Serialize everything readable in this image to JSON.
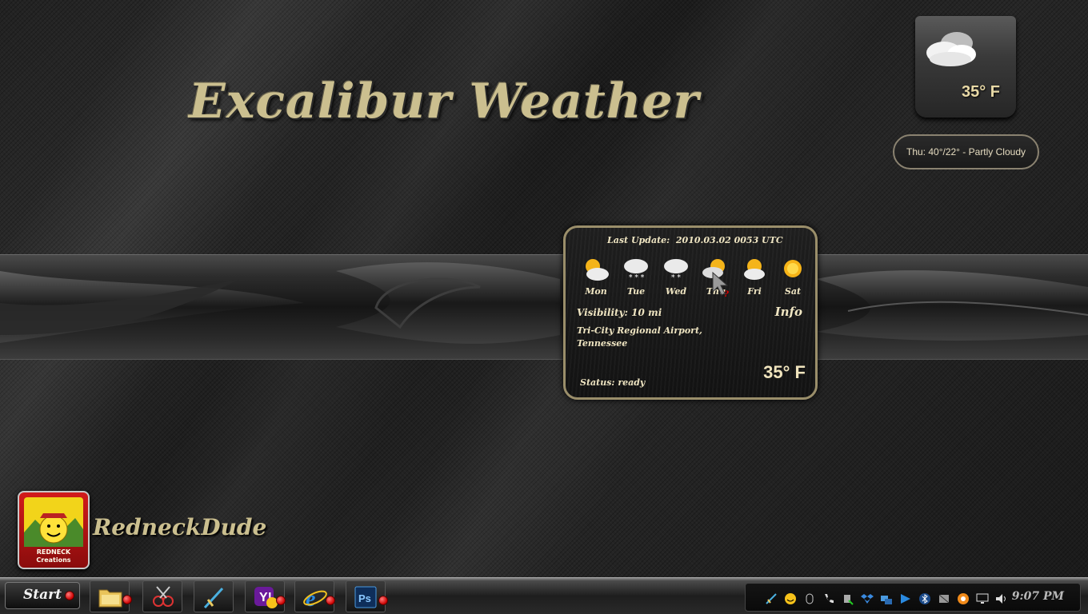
{
  "desktop": {
    "title_logo": "Excalibur Weather",
    "user_name": "RedneckDude",
    "user_badge_text": [
      "REDNECK",
      "Creations"
    ]
  },
  "mini_widget": {
    "temperature": "35° F",
    "icon": "partly-cloudy-icon",
    "forecast": "Thu: 40°/22° - Partly Cloudy"
  },
  "weather_panel": {
    "last_update_label": "Last Update:",
    "last_update_value": "2010.03.02 0053 UTC",
    "days": [
      {
        "label": "Mon",
        "icon": "sun-cloud-icon"
      },
      {
        "label": "Tue",
        "icon": "snow-cloud-icon"
      },
      {
        "label": "Wed",
        "icon": "snow-cloud-icon"
      },
      {
        "label": "Thu",
        "icon": "sun-cloud-icon"
      },
      {
        "label": "Fri",
        "icon": "sun-cloud-icon"
      },
      {
        "label": "Sat",
        "icon": "sun-icon"
      }
    ],
    "visibility": "Visibility: 10 mi",
    "info_link": "Info",
    "location": "Tri-City Regional Airport, Tennessee",
    "status": "Status: ready",
    "temperature": "35° F"
  },
  "taskbar": {
    "start_label": "Start",
    "apps": [
      {
        "name": "explorer",
        "icon": "folder-icon"
      },
      {
        "name": "snipping",
        "icon": "scissors-icon"
      },
      {
        "name": "sword",
        "icon": "sword-icon"
      },
      {
        "name": "yahoo-messenger",
        "icon": "yahoo-icon"
      },
      {
        "name": "internet-explorer",
        "icon": "ie-icon"
      },
      {
        "name": "photoshop",
        "icon": "photoshop-icon",
        "text": "Ps"
      }
    ],
    "tray_icons": [
      "sword-icon",
      "smiley-icon",
      "mouse-icon",
      "phone-icon",
      "usb-icon",
      "dropbox-icon",
      "network-icon",
      "flag-icon",
      "bluetooth-icon",
      "antivirus-icon",
      "power-icon",
      "display-icon",
      "volume-icon"
    ],
    "clock": "9:07 PM"
  },
  "colors": {
    "accent_gold": "#cbbf8f",
    "panel_border": "#9a8e6a",
    "status_red": "#cc0000"
  }
}
